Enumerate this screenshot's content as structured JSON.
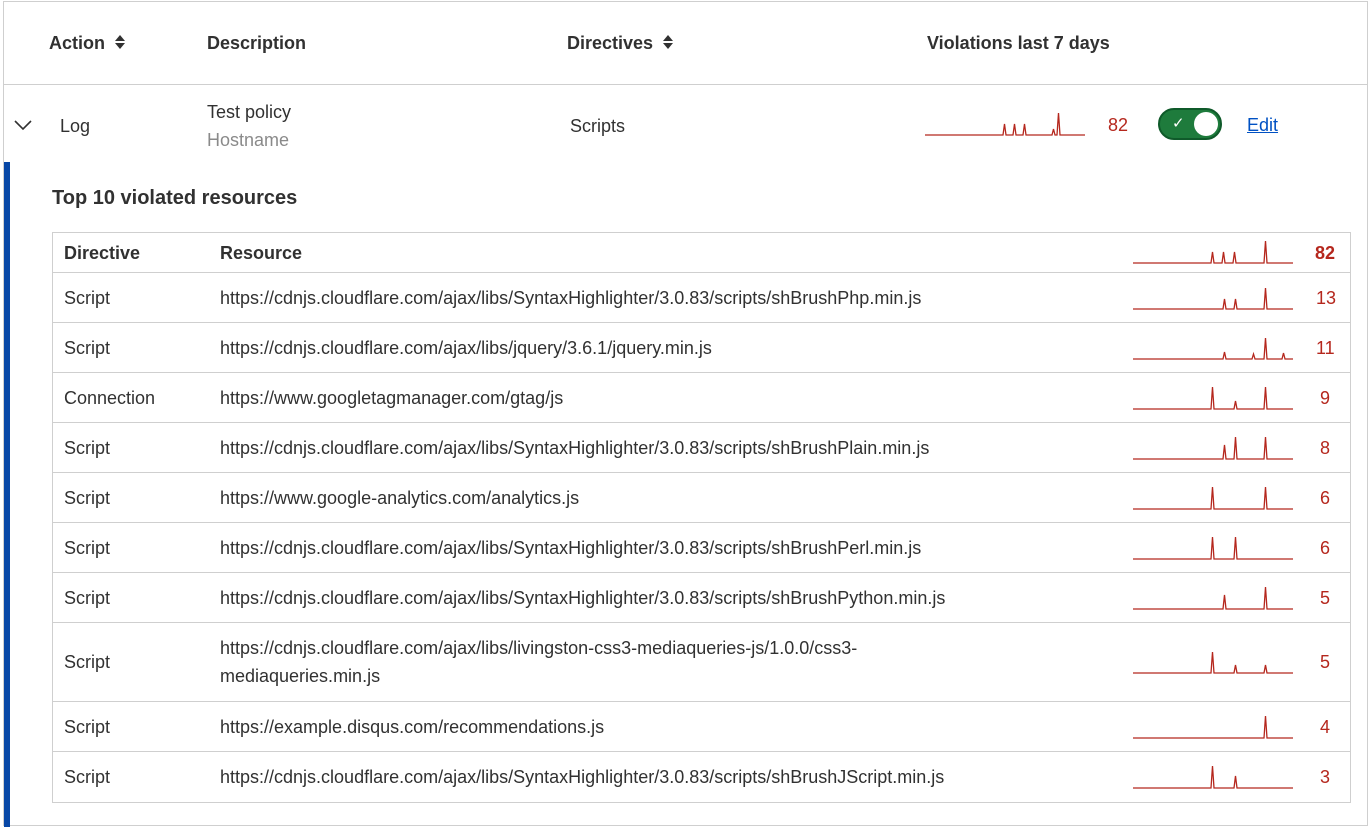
{
  "columns": {
    "action": "Action",
    "description": "Description",
    "directives": "Directives",
    "violations": "Violations last 7 days"
  },
  "icons": {
    "sort": "sort-icon",
    "expand": "chevron-down-icon",
    "toggle_check": "check-icon"
  },
  "colors": {
    "violation_red": "#b5271d",
    "toggle_green": "#1e7b3c",
    "link_blue": "#0051c3",
    "accent_bar": "#0747a6"
  },
  "policy": {
    "action": "Log",
    "description": "Test policy",
    "sub": "Hostname",
    "directives": "Scripts",
    "count": "82",
    "enabled": true,
    "edit_label": "Edit"
  },
  "expanded": {
    "title": "Top 10 violated resources",
    "headers": {
      "directive": "Directive",
      "resource": "Resource",
      "total": "82"
    },
    "rows": [
      {
        "directive": "Script",
        "resource": "https://cdnjs.cloudflare.com/ajax/libs/SyntaxHighlighter/3.0.83/scripts/shBrushPhp.min.js",
        "count": "13"
      },
      {
        "directive": "Script",
        "resource": "https://cdnjs.cloudflare.com/ajax/libs/jquery/3.6.1/jquery.min.js",
        "count": "11"
      },
      {
        "directive": "Connection",
        "resource": "https://www.googletagmanager.com/gtag/js",
        "count": "9"
      },
      {
        "directive": "Script",
        "resource": "https://cdnjs.cloudflare.com/ajax/libs/SyntaxHighlighter/3.0.83/scripts/shBrushPlain.min.js",
        "count": "8"
      },
      {
        "directive": "Script",
        "resource": "https://www.google-analytics.com/analytics.js",
        "count": "6"
      },
      {
        "directive": "Script",
        "resource": "https://cdnjs.cloudflare.com/ajax/libs/SyntaxHighlighter/3.0.83/scripts/shBrushPerl.min.js",
        "count": "6"
      },
      {
        "directive": "Script",
        "resource": "https://cdnjs.cloudflare.com/ajax/libs/SyntaxHighlighter/3.0.83/scripts/shBrushPython.min.js",
        "count": "5"
      },
      {
        "directive": "Script",
        "resource": "https://cdnjs.cloudflare.com/ajax/libs/livingston-css3-mediaqueries-js/1.0.0/css3-mediaqueries.min.js",
        "count": "5"
      },
      {
        "directive": "Script",
        "resource": "https://example.disqus.com/recommendations.js",
        "count": "4"
      },
      {
        "directive": "Script",
        "resource": "https://cdnjs.cloudflare.com/ajax/libs/SyntaxHighlighter/3.0.83/scripts/shBrushJScript.min.js",
        "count": "3"
      }
    ]
  }
}
